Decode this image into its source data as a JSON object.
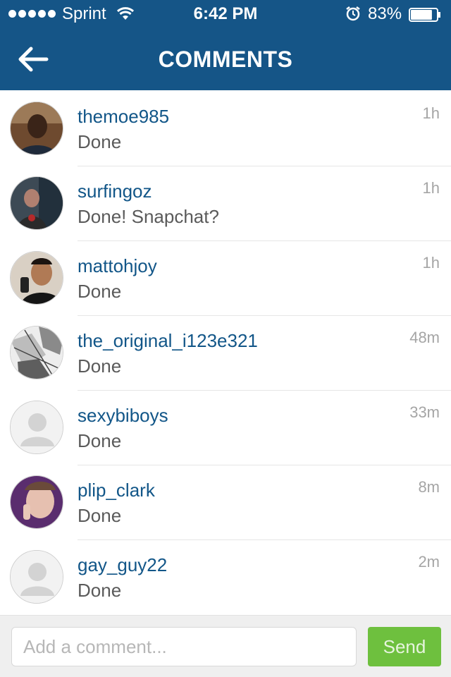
{
  "status_bar": {
    "carrier": "Sprint",
    "time": "6:42 PM",
    "battery": "83%",
    "battery_level": 0.83,
    "signal_bars": 5,
    "icons": [
      "wifi-icon",
      "alarm-icon",
      "battery-icon"
    ]
  },
  "header": {
    "title": "COMMENTS",
    "back_icon": "back-arrow-icon",
    "background": "#155587"
  },
  "comments": [
    {
      "username": "themoe985",
      "text": "Done",
      "time": "1h",
      "avatar": "photo"
    },
    {
      "username": "surfingoz",
      "text": "Done! Snapchat?",
      "time": "1h",
      "avatar": "photo"
    },
    {
      "username": "mattohjoy",
      "text": "Done",
      "time": "1h",
      "avatar": "photo"
    },
    {
      "username": "the_original_i123e321",
      "text": "Done",
      "time": "48m",
      "avatar": "photo"
    },
    {
      "username": "sexybiboys",
      "text": "Done",
      "time": "33m",
      "avatar": "default"
    },
    {
      "username": "plip_clark",
      "text": "Done",
      "time": "8m",
      "avatar": "photo"
    },
    {
      "username": "gay_guy22",
      "text": "Done",
      "time": "2m",
      "avatar": "default"
    }
  ],
  "composer": {
    "placeholder": "Add a comment...",
    "value": "",
    "send_label": "Send",
    "send_color": "#6ec03e"
  },
  "colors": {
    "username": "#125688",
    "comment_text": "#5a5a5a",
    "timestamp": "#a5a5a5"
  }
}
